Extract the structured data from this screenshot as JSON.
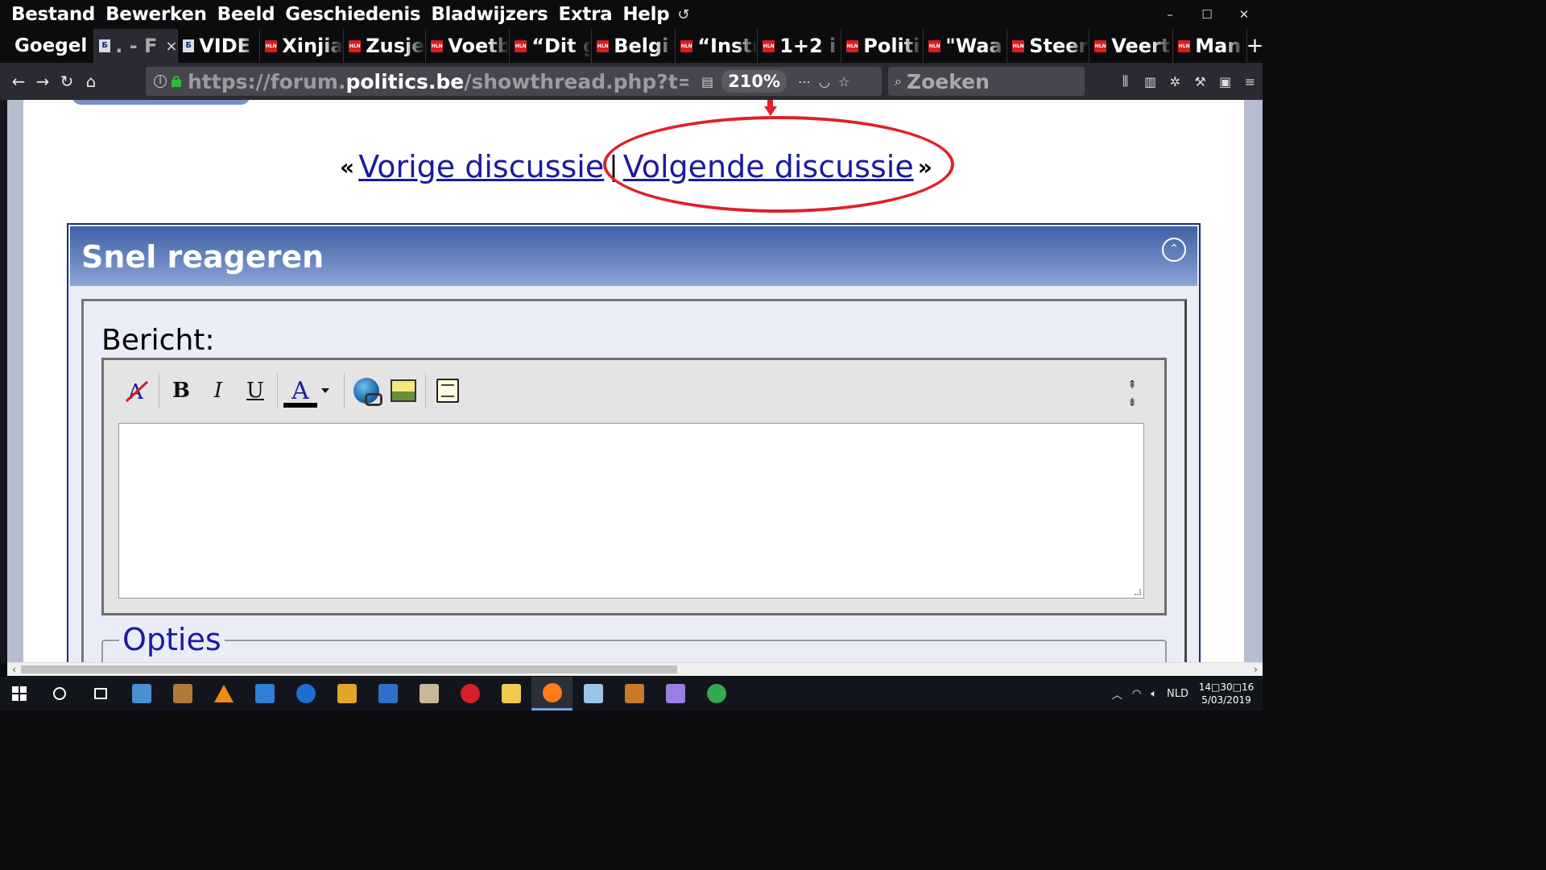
{
  "menubar": {
    "items": [
      "Bestand",
      "Bewerken",
      "Beeld",
      "Geschiedenis",
      "Bladwijzers",
      "Extra",
      "Help"
    ],
    "history_icon": "history-icon",
    "window_controls": [
      "–",
      "☐",
      "✕"
    ]
  },
  "tabs": {
    "first": "Goegel",
    "items": [
      {
        "label": ". - F",
        "favicon": "pb",
        "active": true
      },
      {
        "label": "VIDE",
        "favicon": "pb"
      },
      {
        "label": "Xinjia",
        "favicon": "hln"
      },
      {
        "label": "Zusje",
        "favicon": "hln"
      },
      {
        "label": "Voetb",
        "favicon": "hln"
      },
      {
        "label": "“Dit g",
        "favicon": "hln"
      },
      {
        "label": "Belgi",
        "favicon": "hln"
      },
      {
        "label": "“Instr",
        "favicon": "hln"
      },
      {
        "label": "1+2 i",
        "favicon": "hln"
      },
      {
        "label": "Politi",
        "favicon": "hln"
      },
      {
        "label": "\"Waa",
        "favicon": "hln"
      },
      {
        "label": "Steer",
        "favicon": "hln"
      },
      {
        "label": "Veert",
        "favicon": "hln"
      },
      {
        "label": "Man",
        "favicon": "hln"
      }
    ],
    "favicon_texts": {
      "hln": "HLN",
      "pb": "Ƃ"
    },
    "close_glyph": "×",
    "new_tab_glyph": "+"
  },
  "navbar": {
    "back": "←",
    "forward": "→",
    "reload": "↻",
    "home": "⌂",
    "url_prefix": "https://forum.",
    "url_domain": "politics.be",
    "url_suffix": "/showthread.php?t=",
    "zoom": "210%",
    "search_placeholder": "Zoeken",
    "url_action_icons": [
      "⋯",
      "◡",
      "☆"
    ]
  },
  "page": {
    "prev_arrow": "«",
    "prev_link": "Vorige discussie",
    "separator": "|",
    "next_link": "Volgende discussie",
    "next_arrow": "»",
    "annotation_color": "#e0202a",
    "quick_reply": {
      "title": "Snel reageren",
      "message_label": "Bericht:",
      "options_legend": "Opties",
      "toolbar": {
        "bold": "B",
        "italic": "I",
        "underline": "U",
        "font_color": "A"
      }
    }
  },
  "taskbar": {
    "apps": [
      "search-icon",
      "task-view-icon",
      "app-icon",
      "app-icon",
      "vlc-icon",
      "app-icon",
      "ie-icon",
      "app-icon",
      "defender-icon",
      "paint-icon",
      "opera-icon",
      "explorer-icon",
      "firefox-icon",
      "app-icon",
      "app-icon",
      "app-icon",
      "chrome-icon"
    ],
    "language": "NLD",
    "time": "14□30□16",
    "date": "5/03/2019"
  }
}
